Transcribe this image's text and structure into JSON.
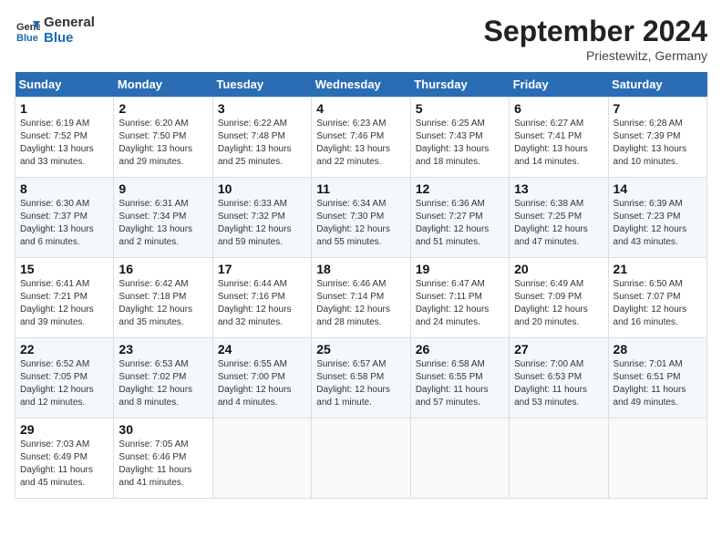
{
  "app": {
    "logo_line1": "General",
    "logo_line2": "Blue"
  },
  "title": "September 2024",
  "subtitle": "Priestewitz, Germany",
  "days_of_week": [
    "Sunday",
    "Monday",
    "Tuesday",
    "Wednesday",
    "Thursday",
    "Friday",
    "Saturday"
  ],
  "weeks": [
    [
      {
        "day": "1",
        "info": "Sunrise: 6:19 AM\nSunset: 7:52 PM\nDaylight: 13 hours\nand 33 minutes."
      },
      {
        "day": "2",
        "info": "Sunrise: 6:20 AM\nSunset: 7:50 PM\nDaylight: 13 hours\nand 29 minutes."
      },
      {
        "day": "3",
        "info": "Sunrise: 6:22 AM\nSunset: 7:48 PM\nDaylight: 13 hours\nand 25 minutes."
      },
      {
        "day": "4",
        "info": "Sunrise: 6:23 AM\nSunset: 7:46 PM\nDaylight: 13 hours\nand 22 minutes."
      },
      {
        "day": "5",
        "info": "Sunrise: 6:25 AM\nSunset: 7:43 PM\nDaylight: 13 hours\nand 18 minutes."
      },
      {
        "day": "6",
        "info": "Sunrise: 6:27 AM\nSunset: 7:41 PM\nDaylight: 13 hours\nand 14 minutes."
      },
      {
        "day": "7",
        "info": "Sunrise: 6:28 AM\nSunset: 7:39 PM\nDaylight: 13 hours\nand 10 minutes."
      }
    ],
    [
      {
        "day": "8",
        "info": "Sunrise: 6:30 AM\nSunset: 7:37 PM\nDaylight: 13 hours\nand 6 minutes."
      },
      {
        "day": "9",
        "info": "Sunrise: 6:31 AM\nSunset: 7:34 PM\nDaylight: 13 hours\nand 2 minutes."
      },
      {
        "day": "10",
        "info": "Sunrise: 6:33 AM\nSunset: 7:32 PM\nDaylight: 12 hours\nand 59 minutes."
      },
      {
        "day": "11",
        "info": "Sunrise: 6:34 AM\nSunset: 7:30 PM\nDaylight: 12 hours\nand 55 minutes."
      },
      {
        "day": "12",
        "info": "Sunrise: 6:36 AM\nSunset: 7:27 PM\nDaylight: 12 hours\nand 51 minutes."
      },
      {
        "day": "13",
        "info": "Sunrise: 6:38 AM\nSunset: 7:25 PM\nDaylight: 12 hours\nand 47 minutes."
      },
      {
        "day": "14",
        "info": "Sunrise: 6:39 AM\nSunset: 7:23 PM\nDaylight: 12 hours\nand 43 minutes."
      }
    ],
    [
      {
        "day": "15",
        "info": "Sunrise: 6:41 AM\nSunset: 7:21 PM\nDaylight: 12 hours\nand 39 minutes."
      },
      {
        "day": "16",
        "info": "Sunrise: 6:42 AM\nSunset: 7:18 PM\nDaylight: 12 hours\nand 35 minutes."
      },
      {
        "day": "17",
        "info": "Sunrise: 6:44 AM\nSunset: 7:16 PM\nDaylight: 12 hours\nand 32 minutes."
      },
      {
        "day": "18",
        "info": "Sunrise: 6:46 AM\nSunset: 7:14 PM\nDaylight: 12 hours\nand 28 minutes."
      },
      {
        "day": "19",
        "info": "Sunrise: 6:47 AM\nSunset: 7:11 PM\nDaylight: 12 hours\nand 24 minutes."
      },
      {
        "day": "20",
        "info": "Sunrise: 6:49 AM\nSunset: 7:09 PM\nDaylight: 12 hours\nand 20 minutes."
      },
      {
        "day": "21",
        "info": "Sunrise: 6:50 AM\nSunset: 7:07 PM\nDaylight: 12 hours\nand 16 minutes."
      }
    ],
    [
      {
        "day": "22",
        "info": "Sunrise: 6:52 AM\nSunset: 7:05 PM\nDaylight: 12 hours\nand 12 minutes."
      },
      {
        "day": "23",
        "info": "Sunrise: 6:53 AM\nSunset: 7:02 PM\nDaylight: 12 hours\nand 8 minutes."
      },
      {
        "day": "24",
        "info": "Sunrise: 6:55 AM\nSunset: 7:00 PM\nDaylight: 12 hours\nand 4 minutes."
      },
      {
        "day": "25",
        "info": "Sunrise: 6:57 AM\nSunset: 6:58 PM\nDaylight: 12 hours\nand 1 minute."
      },
      {
        "day": "26",
        "info": "Sunrise: 6:58 AM\nSunset: 6:55 PM\nDaylight: 11 hours\nand 57 minutes."
      },
      {
        "day": "27",
        "info": "Sunrise: 7:00 AM\nSunset: 6:53 PM\nDaylight: 11 hours\nand 53 minutes."
      },
      {
        "day": "28",
        "info": "Sunrise: 7:01 AM\nSunset: 6:51 PM\nDaylight: 11 hours\nand 49 minutes."
      }
    ],
    [
      {
        "day": "29",
        "info": "Sunrise: 7:03 AM\nSunset: 6:49 PM\nDaylight: 11 hours\nand 45 minutes."
      },
      {
        "day": "30",
        "info": "Sunrise: 7:05 AM\nSunset: 6:46 PM\nDaylight: 11 hours\nand 41 minutes."
      },
      {
        "day": "",
        "info": ""
      },
      {
        "day": "",
        "info": ""
      },
      {
        "day": "",
        "info": ""
      },
      {
        "day": "",
        "info": ""
      },
      {
        "day": "",
        "info": ""
      }
    ]
  ]
}
